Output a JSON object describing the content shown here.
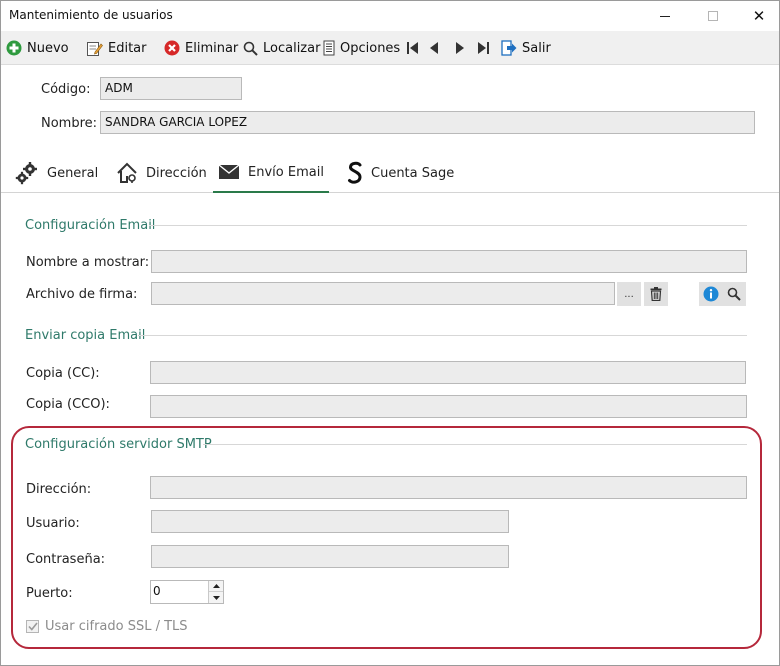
{
  "window": {
    "title": "Mantenimiento de usuarios",
    "controls": {
      "minimize": "minimize-icon",
      "maximize": "maximize-icon",
      "close": "✕"
    }
  },
  "toolbar": {
    "nuevo": "Nuevo",
    "editar": "Editar",
    "eliminar": "Eliminar",
    "localizar": "Localizar",
    "opciones": "Opciones",
    "salir": "Salir"
  },
  "header": {
    "codigo_label": "Código:",
    "codigo_value": "ADM",
    "nombre_label": "Nombre:",
    "nombre_value": "SANDRA GARCIA LOPEZ"
  },
  "tabs": [
    {
      "label": "General",
      "icon": "gears-icon"
    },
    {
      "label": "Dirección",
      "icon": "house-icon"
    },
    {
      "label": "Envío Email",
      "icon": "envelope-icon",
      "active": true
    },
    {
      "label": "Cuenta Sage",
      "icon": "sage-icon"
    }
  ],
  "email_config": {
    "title": "Configuración Email",
    "nombre_mostrar_label": "Nombre a mostrar:",
    "nombre_mostrar_value": "",
    "archivo_firma_label": "Archivo de firma:",
    "archivo_firma_value": "",
    "browse_label": "..."
  },
  "copia": {
    "title": "Enviar copia Email",
    "cc_label": "Copia (CC):",
    "cc_value": "",
    "cco_label": "Copia (CCO):",
    "cco_value": ""
  },
  "smtp": {
    "title": "Configuración servidor SMTP",
    "direccion_label": "Dirección:",
    "direccion_value": "",
    "usuario_label": "Usuario:",
    "usuario_value": "",
    "contrasena_label": "Contraseña:",
    "contrasena_value": "",
    "puerto_label": "Puerto:",
    "puerto_value": "0",
    "ssl_label": "Usar cifrado SSL / TLS",
    "ssl_checked": true
  },
  "colors": {
    "accent_green": "#2a7a4a",
    "section_title": "#2f7a6a",
    "highlight_border": "#b5283b",
    "info_blue": "#1e88d6",
    "delete_red": "#d62828"
  }
}
